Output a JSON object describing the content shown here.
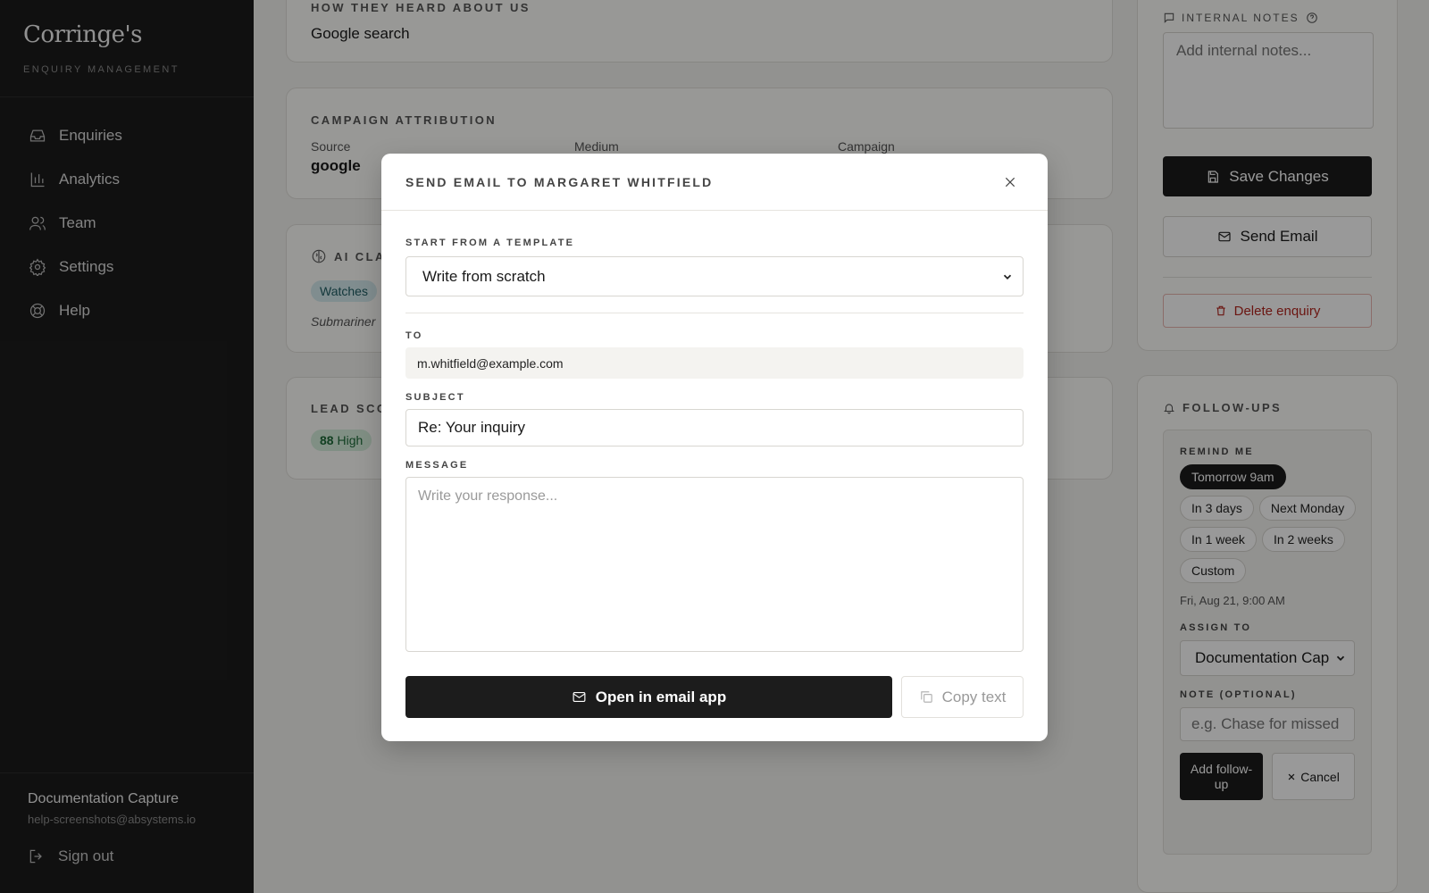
{
  "sidebar": {
    "logo": "Corringe's",
    "subtitle": "ENQUIRY MANAGEMENT",
    "nav": [
      {
        "label": "Enquiries",
        "icon": "inbox-icon"
      },
      {
        "label": "Analytics",
        "icon": "bar-chart-icon"
      },
      {
        "label": "Team",
        "icon": "users-icon"
      },
      {
        "label": "Settings",
        "icon": "gear-icon"
      },
      {
        "label": "Help",
        "icon": "lifebuoy-icon"
      }
    ],
    "user_name": "Documentation Capture",
    "user_email": "help-screenshots@absystems.io",
    "signout": "Sign out"
  },
  "main": {
    "heard_title": "HOW THEY HEARD ABOUT US",
    "heard_value": "Google search",
    "campaign_title": "CAMPAIGN ATTRIBUTION",
    "campaign_source_label": "Source",
    "campaign_source_value": "google",
    "campaign_medium_label": "Medium",
    "campaign_campaign_label": "Campaign",
    "ai_title": "AI CLA",
    "ai_tag": "Watches",
    "ai_text": "Submariner",
    "lead_title": "LEAD SCO",
    "lead_score": "88",
    "lead_level": "High"
  },
  "right": {
    "notes_label": "INTERNAL NOTES",
    "notes_placeholder": "Add internal notes...",
    "save": "Save Changes",
    "send_email": "Send Email",
    "delete": "Delete enquiry",
    "followups_title": "FOLLOW-UPS",
    "remind_label": "REMIND ME",
    "chips": [
      "Tomorrow 9am",
      "In 3 days",
      "Next Monday",
      "In 1 week",
      "In 2 weeks",
      "Custom"
    ],
    "reminder_time": "Fri, Aug 21, 9:00 AM",
    "assign_label": "ASSIGN TO",
    "assign_value": "Documentation Cap",
    "note_label": "NOTE (OPTIONAL)",
    "note_placeholder": "e.g. Chase for missed c",
    "add_followup": "Add follow-up",
    "cancel": "Cancel"
  },
  "modal": {
    "title": "SEND EMAIL TO MARGARET WHITFIELD",
    "template_label": "START FROM A TEMPLATE",
    "template_value": "Write from scratch",
    "to_label": "TO",
    "to_value": "m.whitfield@example.com",
    "subject_label": "SUBJECT",
    "subject_value": "Re: Your inquiry",
    "message_label": "MESSAGE",
    "message_placeholder": "Write your response...",
    "open_email": "Open in email app",
    "copy_text": "Copy text"
  },
  "colors": {
    "sidebar_bg": "#1c1c1c",
    "accent_dark": "#1c1c1c",
    "danger": "#b3261e",
    "tag_teal_bg": "#d6ecee",
    "score_green_bg": "#d5eedc"
  }
}
